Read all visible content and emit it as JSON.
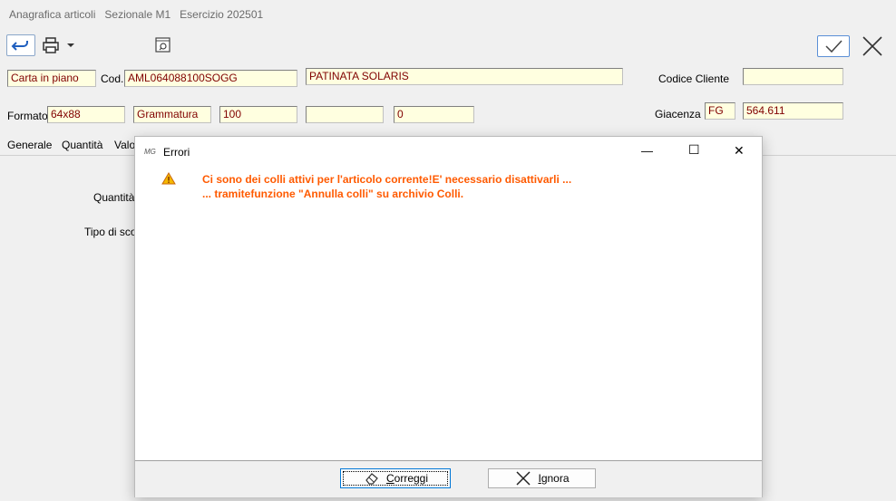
{
  "window": {
    "title": "Anagrafica articoli",
    "sezionale": "Sezionale M1",
    "esercizio": "Esercizio 202501"
  },
  "toolbar": {
    "back_icon": "back-arrow-icon",
    "print_icon": "printer-icon",
    "preview_icon": "preview-icon",
    "confirm_icon": "check-icon",
    "close_icon": "close-icon"
  },
  "form": {
    "row1": {
      "tipo": "Carta in piano",
      "cod_label": "Cod.",
      "cod_value": "AML064088100SOGG",
      "descrizione": "PATINATA SOLARIS",
      "codice_cliente_label": "Codice Cliente",
      "codice_cliente_value": ""
    },
    "row2": {
      "formato_label": "Formato",
      "formato_value": "64x88",
      "grammatura_label": "Grammatura",
      "grammatura_value": "100",
      "extra_value": "",
      "zero_value": "0",
      "giacenza_label": "Giacenza",
      "giacenza_um": "FG",
      "giacenza_value": "564.611"
    }
  },
  "tabs": [
    "Generale",
    "Quantità",
    "Valo"
  ],
  "background_labels": {
    "quantita": "Quantità",
    "tipo_sco": "Tipo di sco"
  },
  "dialog": {
    "title": "Errori",
    "icon_label": "MG",
    "controls": {
      "minimize": "—",
      "maximize": "☐",
      "close": "✕"
    },
    "message_line1": "Ci sono dei colli attivi per l'articolo corrente!E' necessario disattivarli ...",
    "message_line2": "... tramitefunzione \"Annulla colli\" su archivio Colli.",
    "buttons": {
      "correggi": {
        "label_underlined": "C",
        "label_rest": "orreggi"
      },
      "ignora": {
        "label_underlined": "I",
        "label_rest": "gnora"
      }
    }
  }
}
